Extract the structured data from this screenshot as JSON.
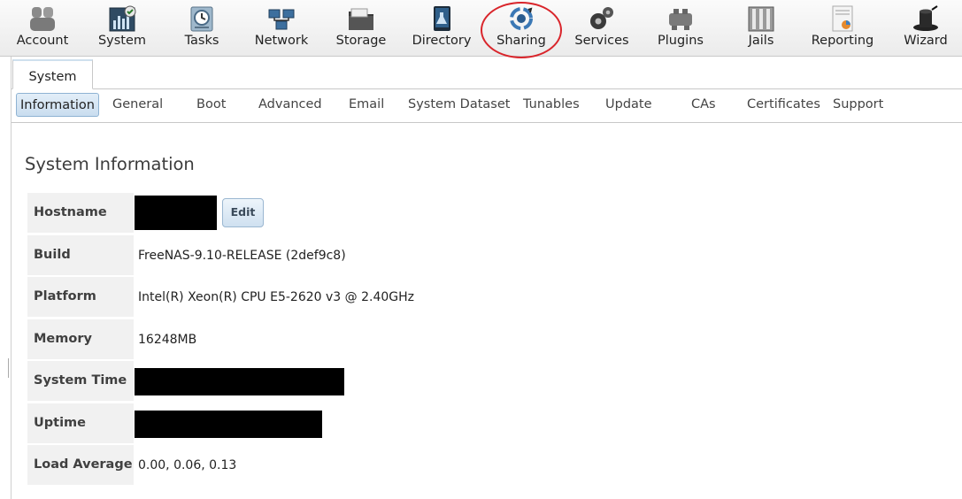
{
  "toolbar": {
    "items": [
      {
        "label": "Account",
        "icon": "account-icon"
      },
      {
        "label": "System",
        "icon": "system-icon"
      },
      {
        "label": "Tasks",
        "icon": "tasks-icon"
      },
      {
        "label": "Network",
        "icon": "network-icon"
      },
      {
        "label": "Storage",
        "icon": "storage-icon"
      },
      {
        "label": "Directory",
        "icon": "directory-icon"
      },
      {
        "label": "Sharing",
        "icon": "sharing-icon"
      },
      {
        "label": "Services",
        "icon": "services-icon"
      },
      {
        "label": "Plugins",
        "icon": "plugins-icon"
      },
      {
        "label": "Jails",
        "icon": "jails-icon"
      },
      {
        "label": "Reporting",
        "icon": "reporting-icon"
      },
      {
        "label": "Wizard",
        "icon": "wizard-icon"
      }
    ],
    "highlight_color": "#d9252b"
  },
  "tabs": {
    "main": "System"
  },
  "subtabs": [
    "Information",
    "General",
    "Boot",
    "Advanced",
    "Email",
    "System Dataset",
    "Tunables",
    "Update",
    "CAs",
    "Certificates",
    "Support"
  ],
  "main": {
    "title": "System Information",
    "edit_label": "Edit",
    "rows": [
      {
        "label": "Hostname",
        "value": ""
      },
      {
        "label": "Build",
        "value": "FreeNAS-9.10-RELEASE (2def9c8)"
      },
      {
        "label": "Platform",
        "value": "Intel(R) Xeon(R) CPU E5-2620 v3 @ 2.40GHz"
      },
      {
        "label": "Memory",
        "value": "16248MB"
      },
      {
        "label": "System Time",
        "value": ""
      },
      {
        "label": "Uptime",
        "value": ""
      },
      {
        "label": "Load Average",
        "value": "0.00, 0.06, 0.13"
      }
    ]
  }
}
